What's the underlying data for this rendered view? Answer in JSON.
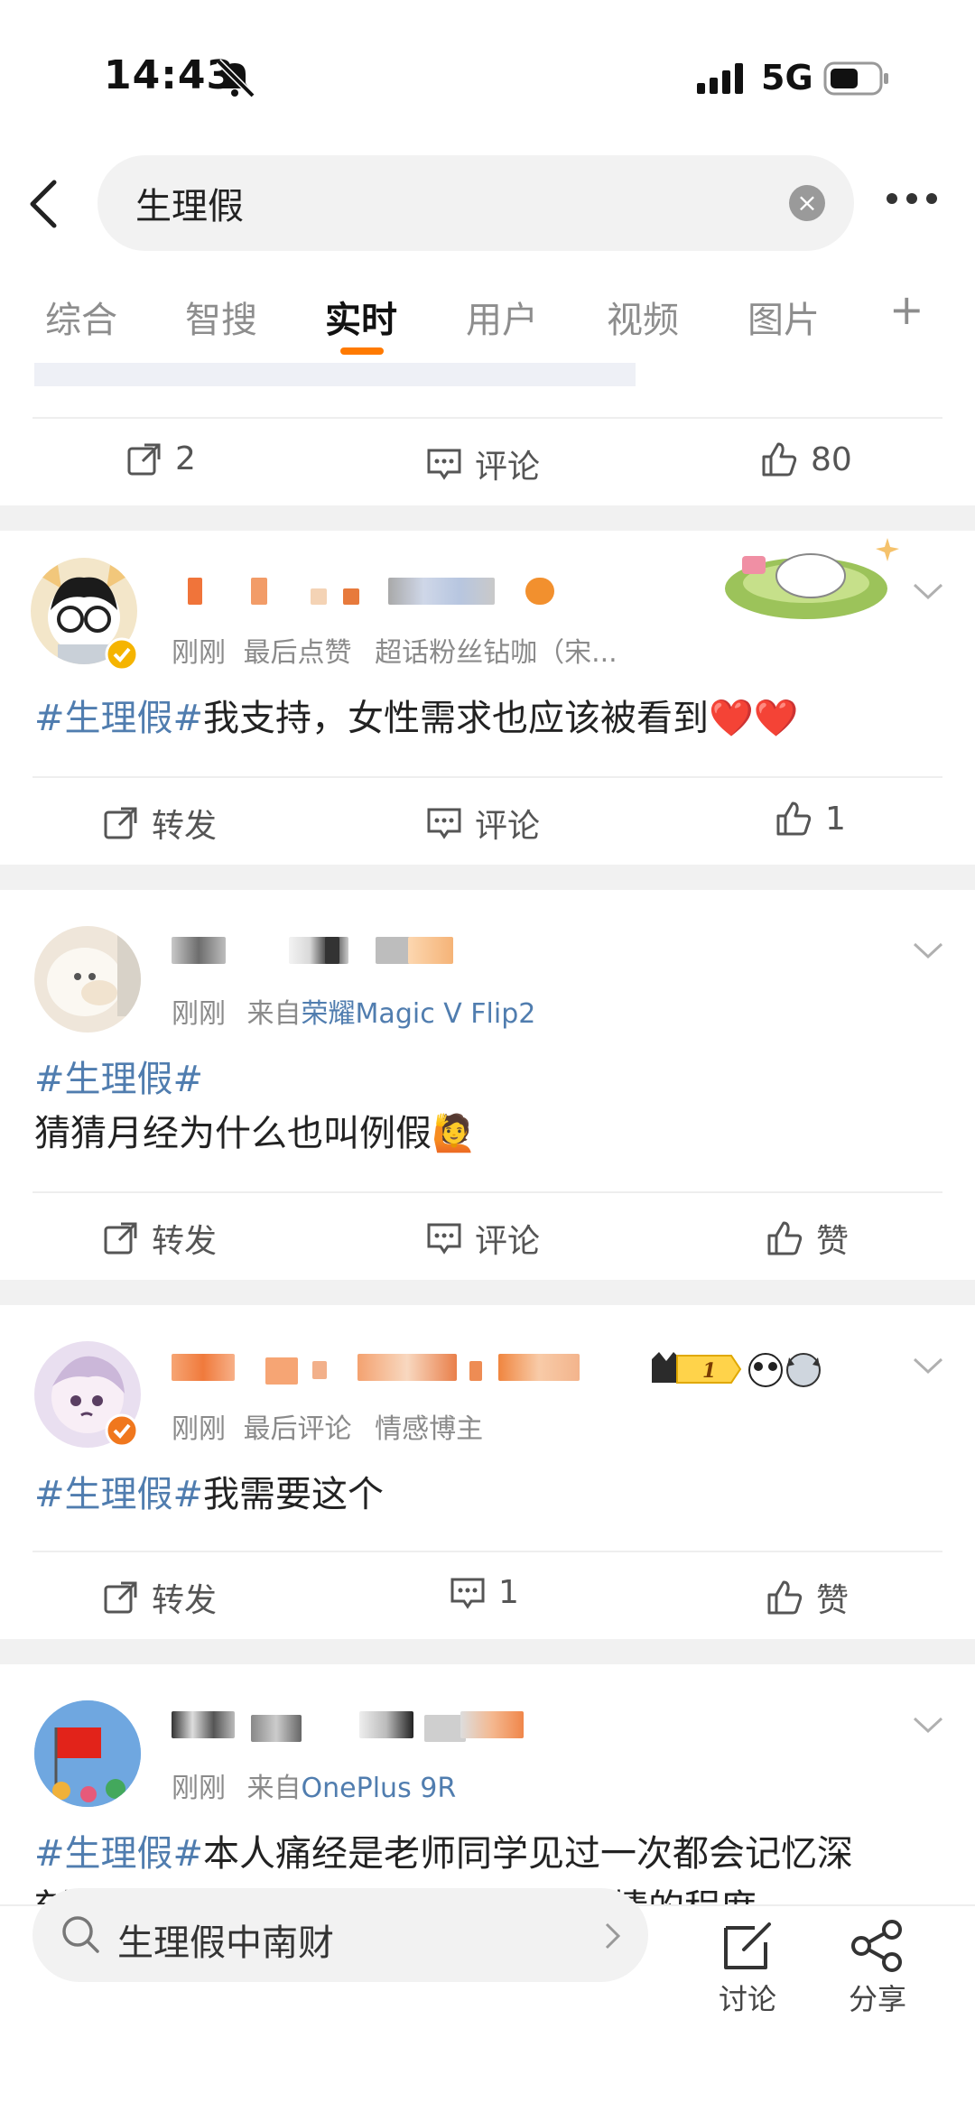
{
  "status_bar": {
    "time": "14:43",
    "network": "5G"
  },
  "search": {
    "query": "生理假"
  },
  "tabs": [
    {
      "label": "综合"
    },
    {
      "label": "智搜"
    },
    {
      "label": "实时"
    },
    {
      "label": "用户"
    },
    {
      "label": "视频"
    },
    {
      "label": "图片"
    },
    {
      "label": "+"
    }
  ],
  "post0": {
    "repost": "2",
    "comment": "评论",
    "like": "80"
  },
  "post1": {
    "time": "刚刚",
    "meta": "最后点赞",
    "badge": "超话粉丝钻咖（宋...",
    "tag": "#生理假#",
    "text": "我支持，女性需求也应该被看到❤️❤️",
    "repost": "转发",
    "comment": "评论",
    "like": "1"
  },
  "post2": {
    "time": "刚刚",
    "from": "来自",
    "device": "荣耀Magic V Flip2",
    "tag": "#生理假#",
    "text": "猜猜月经为什么也叫例假🙋",
    "repost": "转发",
    "comment": "评论",
    "like": "赞"
  },
  "post3": {
    "time": "刚刚",
    "meta": "最后评论",
    "badge": "情感博主",
    "tag": "#生理假#",
    "text": "我需要这个",
    "level": "1",
    "repost": "转发",
    "comment": "1",
    "like": "赞"
  },
  "post4": {
    "time": "刚刚",
    "from": "来自",
    "device": "OnePlus 9R",
    "tag": "#生理假#",
    "text": "本人痛经是老师同学见过一次都会记忆深",
    "text2": "刻，害怕我月经期间随时会出什么事情的程度"
  },
  "bottom": {
    "search_text": "生理假中南财",
    "discuss": "讨论",
    "share": "分享"
  },
  "colors": {
    "accent": "#ff7a00",
    "link": "#507daf"
  }
}
